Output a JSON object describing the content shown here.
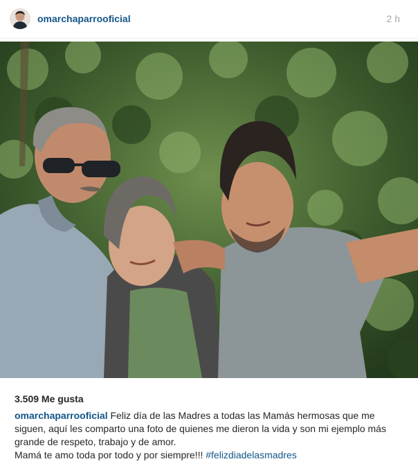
{
  "post": {
    "username": "omarchaparrooficial",
    "time": "2 h",
    "likes": "3.509 Me gusta",
    "caption": {
      "username": "omarchaparrooficial",
      "line1": "Feliz día de las Madres a todas las Mamás hermosas que me siguen, aquí les comparto una foto de quienes me dieron la vida y son mi ejemplo más grande de respeto, trabajo y de amor.",
      "line2": "Mamá te amo toda por todo y por siempre!!! ",
      "hashtag": "#felizdiadelasmadres"
    },
    "colors": {
      "username": "#125688",
      "time": "#a5a7aa",
      "text": "#262626"
    },
    "photo": {
      "subject": "three people posing outdoors in front of green foliage"
    }
  }
}
